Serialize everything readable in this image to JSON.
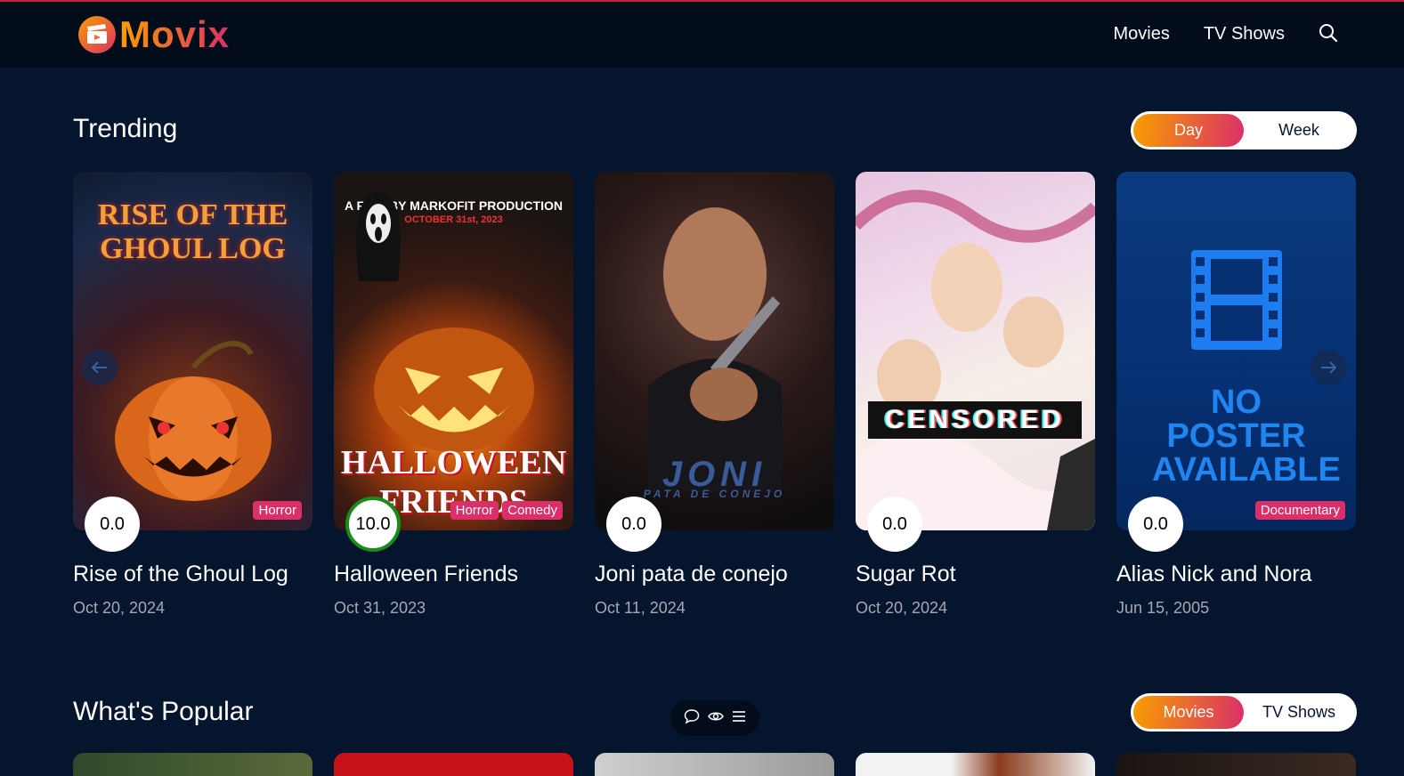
{
  "header": {
    "logo_text": "Movix",
    "nav": [
      {
        "label": "Movies"
      },
      {
        "label": "TV Shows"
      }
    ]
  },
  "trending": {
    "title": "Trending",
    "switch": [
      "Day",
      "Week"
    ],
    "active": "Day",
    "cards": [
      {
        "title": "Rise of the Ghoul Log",
        "date": "Oct 20, 2024",
        "rating": "0.0",
        "genres": [
          "Horror"
        ],
        "poster_text": "RISE OF THE GHOUL LOG"
      },
      {
        "title": "Halloween Friends",
        "date": "Oct 31, 2023",
        "rating": "10.0",
        "genres": [
          "Horror",
          "Comedy"
        ],
        "poster_text": "HALLOWEEN FRIENDS",
        "poster_top": "A FILM BY MARKOFIT PRODUCTION",
        "poster_date": "OCTOBER 31st, 2023"
      },
      {
        "title": "Joni pata de conejo",
        "date": "Oct 11, 2024",
        "rating": "0.0",
        "genres": [],
        "poster_text": "JONI",
        "poster_sub": "PATA DE CONEJO"
      },
      {
        "title": "Sugar Rot",
        "date": "Oct 20, 2024",
        "rating": "0.0",
        "genres": [],
        "poster_text": "CENSORED"
      },
      {
        "title": "Alias Nick and Nora",
        "date": "Jun 15, 2005",
        "rating": "0.0",
        "genres": [
          "Documentary"
        ],
        "poster_text": "NO POSTER AVAILABLE"
      }
    ]
  },
  "popular": {
    "title": "What's Popular",
    "switch": [
      "Movies",
      "TV Shows"
    ],
    "active": "Movies"
  },
  "colors": {
    "background": "#04152d",
    "header": "#020c1b",
    "gradient_start": "#f89e00",
    "gradient_end": "#da2f68",
    "genre": "#da2f68",
    "rating_ring_high": "#198c1a"
  }
}
